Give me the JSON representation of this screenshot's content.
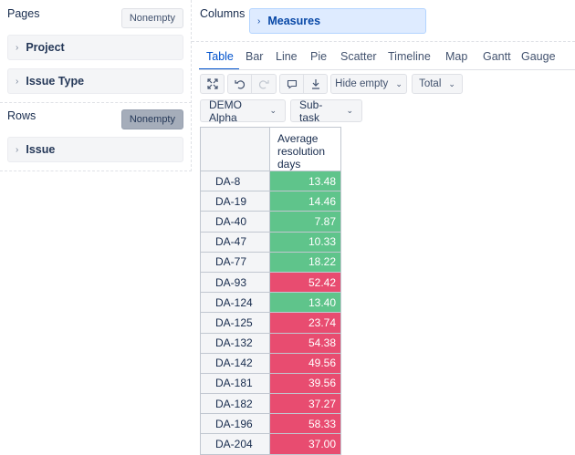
{
  "pages": {
    "label": "Pages",
    "nonempty_label": "Nonempty",
    "items": [
      {
        "label": "Project"
      },
      {
        "label": "Issue Type"
      }
    ]
  },
  "rows": {
    "label": "Rows",
    "nonempty_label": "Nonempty",
    "items": [
      {
        "label": "Issue"
      }
    ]
  },
  "columns": {
    "label": "Columns",
    "items": [
      {
        "label": "Measures"
      }
    ]
  },
  "tabs": [
    "Table",
    "Bar",
    "Line",
    "Pie",
    "Scatter",
    "Timeline",
    "Map",
    "Gantt",
    "Gauge"
  ],
  "active_tab": "Table",
  "toolbar": {
    "icons": [
      "expand-icon",
      "undo-icon",
      "redo-icon",
      "comment-icon",
      "download-icon"
    ],
    "hide_empty_label": "Hide empty",
    "total_label": "Total"
  },
  "filters": {
    "project": "DEMO Alpha",
    "issue_type": "Sub-task"
  },
  "table": {
    "measure_header": [
      "Average",
      "resolution",
      "days"
    ],
    "rows": [
      {
        "issue": "DA-8",
        "value": "13.48",
        "status": "good"
      },
      {
        "issue": "DA-19",
        "value": "14.46",
        "status": "good"
      },
      {
        "issue": "DA-40",
        "value": "7.87",
        "status": "good"
      },
      {
        "issue": "DA-47",
        "value": "10.33",
        "status": "good"
      },
      {
        "issue": "DA-77",
        "value": "18.22",
        "status": "good"
      },
      {
        "issue": "DA-93",
        "value": "52.42",
        "status": "bad"
      },
      {
        "issue": "DA-124",
        "value": "13.40",
        "status": "good"
      },
      {
        "issue": "DA-125",
        "value": "23.74",
        "status": "bad"
      },
      {
        "issue": "DA-132",
        "value": "54.38",
        "status": "bad"
      },
      {
        "issue": "DA-142",
        "value": "49.56",
        "status": "bad"
      },
      {
        "issue": "DA-181",
        "value": "39.56",
        "status": "bad"
      },
      {
        "issue": "DA-182",
        "value": "37.27",
        "status": "bad"
      },
      {
        "issue": "DA-196",
        "value": "58.33",
        "status": "bad"
      },
      {
        "issue": "DA-204",
        "value": "37.00",
        "status": "bad"
      }
    ]
  },
  "colors": {
    "good": "#5fc48b",
    "bad": "#e84c70",
    "accent": "#0052cc"
  }
}
